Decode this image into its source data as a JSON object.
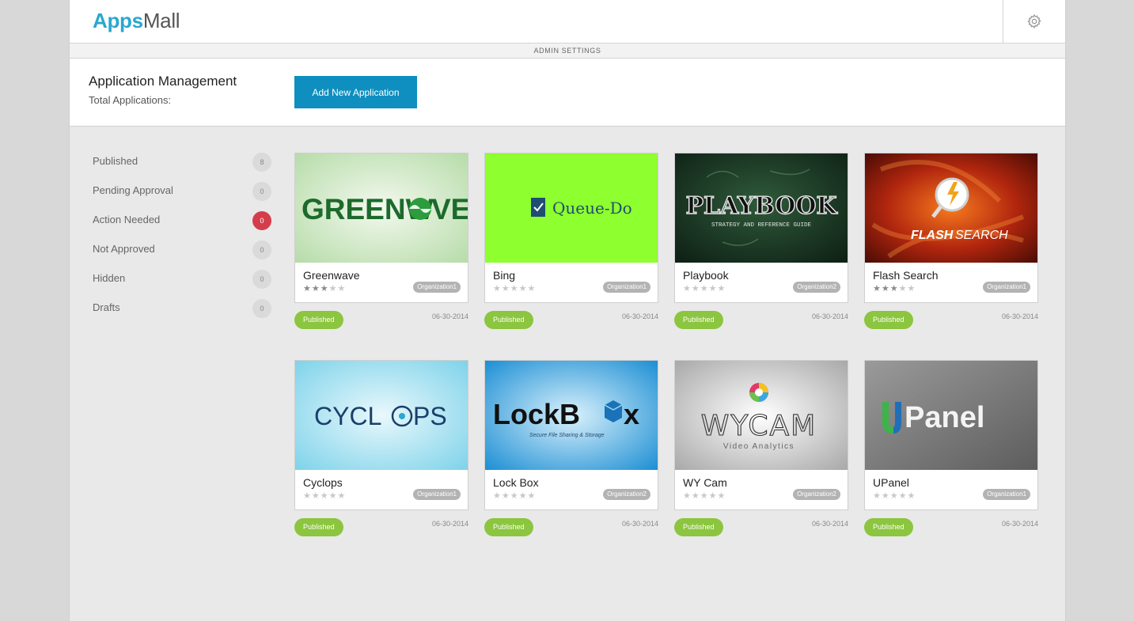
{
  "brand": {
    "apps": "Apps",
    "mall": "Mall"
  },
  "admin_bar": "ADMIN SETTINGS",
  "header": {
    "title": "Application Management",
    "total_label": "Total Applications:",
    "add_button": "Add New Application"
  },
  "sidebar": {
    "items": [
      {
        "label": "Published",
        "count": "8"
      },
      {
        "label": "Pending Approval",
        "count": "0"
      },
      {
        "label": "Action Needed",
        "count": "0"
      },
      {
        "label": "Not Approved",
        "count": "0"
      },
      {
        "label": "Hidden",
        "count": "0"
      },
      {
        "label": "Drafts",
        "count": "0"
      }
    ]
  },
  "apps": [
    {
      "name": "Greenwave",
      "logo_text": "GREENW",
      "logo_text2": "VE",
      "org": "Organization1",
      "rating": 3,
      "status": "Published",
      "date": "06-30-2014"
    },
    {
      "name": "Bing",
      "logo_text": "Queue-Do",
      "org": "Organization1",
      "rating": 0,
      "status": "Published",
      "date": "06-30-2014"
    },
    {
      "name": "Playbook",
      "logo_text": "PLAYBOOK",
      "logo_sub": "STRATEGY AND REFERENCE GUIDE",
      "org": "Organization2",
      "rating": 0,
      "status": "Published",
      "date": "06-30-2014"
    },
    {
      "name": "Flash Search",
      "logo_text": "FLASH",
      "logo_text2": "SEARCH",
      "org": "Organization1",
      "rating": 3,
      "status": "Published",
      "date": "06-30-2014"
    },
    {
      "name": "Cyclops",
      "logo_text": "CYCL",
      "logo_text2": "PS",
      "org": "Organization1",
      "rating": 0,
      "status": "Published",
      "date": "06-30-2014"
    },
    {
      "name": "Lock Box",
      "logo_text": "LockB",
      "logo_text2": "x",
      "logo_sub": "Secure File Sharing & Storage",
      "org": "Organization2",
      "rating": 0,
      "status": "Published",
      "date": "06-30-2014"
    },
    {
      "name": "WY Cam",
      "logo_text": "WYCAM",
      "logo_sub": "Video Analytics",
      "org": "Organization2",
      "rating": 0,
      "status": "Published",
      "date": "06-30-2014"
    },
    {
      "name": "UPanel",
      "logo_text": "Panel",
      "org": "Organization1",
      "rating": 0,
      "status": "Published",
      "date": "06-30-2014"
    }
  ]
}
